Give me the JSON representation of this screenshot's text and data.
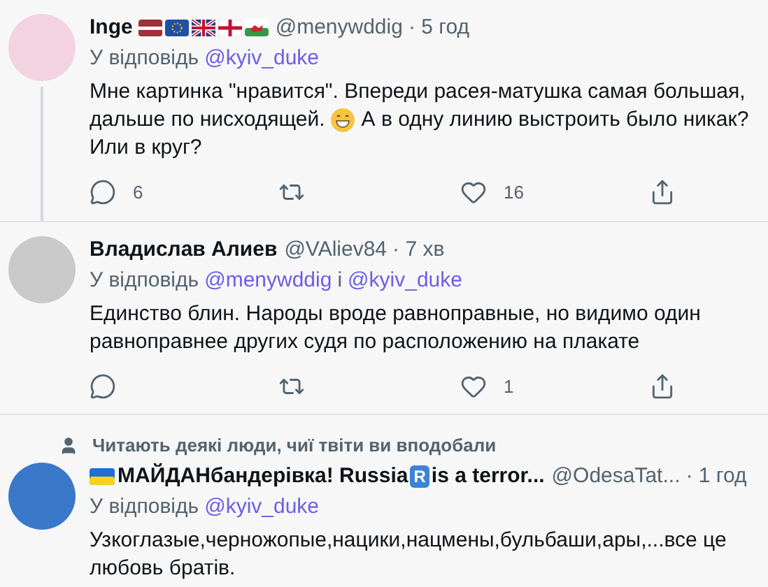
{
  "tweets": [
    {
      "kind": "flags",
      "name": "Inge",
      "handle": "@menywddig",
      "time": "· 5 год",
      "reply_prefix": "У відповідь",
      "reply_to": [
        "@kyiv_duke"
      ],
      "thread_line": true,
      "body": [
        [
          {
            "kind": "text",
            "text": "Мне картинка \"нравится\". Впереди расея-матушка самая большая,"
          }
        ],
        [
          {
            "kind": "text",
            "text": "дальше по нисходящей."
          },
          {
            "kind": "emoji"
          },
          {
            "kind": "text",
            "text": "А в одну линию выстроить было никак?"
          }
        ],
        [
          {
            "kind": "text",
            "text": "Или в круг?"
          }
        ]
      ],
      "replies": "6",
      "likes": "16"
    },
    {
      "kind": "plain",
      "name": "Владислав Алиев",
      "handle": "@VAliev84",
      "time": "· 7 хв",
      "reply_prefix": "У відповідь",
      "reply_to": [
        "@menywddig",
        "@kyiv_duke"
      ],
      "reply_joiner": "і",
      "body": [
        [
          {
            "kind": "text",
            "text": "Единство блин. Народы вроде равноправные, но видимо один равноправнее других судя по расположению на плакате"
          }
        ]
      ],
      "likes": "1"
    },
    {
      "kind": "badge",
      "social_context": "Читають деякі люди, чиї твіти ви вподобали",
      "name": "МАЙДАНбандерівка! Russia",
      "name_badge": "R",
      "name_rest": "is a terror...",
      "handle": "@OdesaTat...",
      "time": "· 1 год",
      "reply_prefix": "У відповідь",
      "reply_to": [
        "@kyiv_duke"
      ],
      "body": [
        [
          {
            "kind": "text",
            "text": "Узкоглазые,черножопые,нацики,нацмены,бульбаши,ары,...все це любовь братів."
          }
        ]
      ]
    }
  ]
}
